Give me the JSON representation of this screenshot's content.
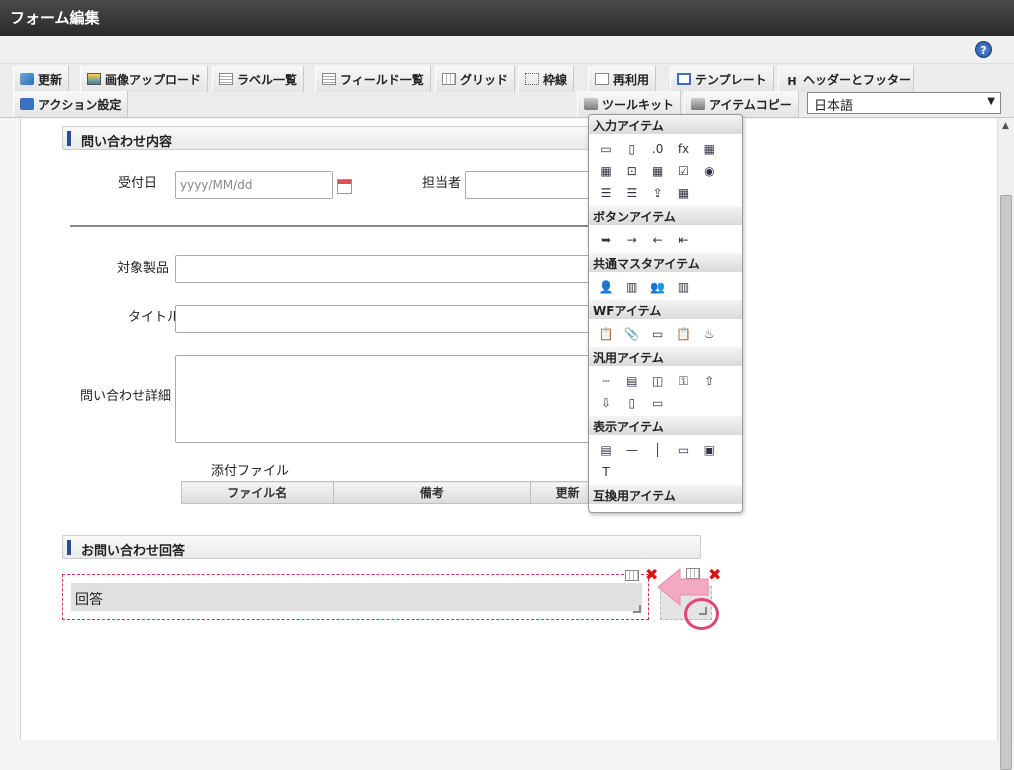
{
  "window": {
    "title": "フォーム編集",
    "help_label": "?"
  },
  "toolbar": {
    "row1": [
      {
        "label": "更新",
        "icon": "update-icon"
      },
      {
        "label": "画像アップロード",
        "icon": "image-upload-icon"
      },
      {
        "label": "ラベル一覧",
        "icon": "label-list-icon"
      },
      {
        "label": "フィールド一覧",
        "icon": "field-list-icon"
      },
      {
        "label": "グリッド",
        "icon": "grid-icon"
      },
      {
        "label": "枠線",
        "icon": "border-icon"
      },
      {
        "label": "再利用",
        "icon": "reuse-icon"
      },
      {
        "label": "テンプレート",
        "icon": "template-icon"
      },
      {
        "label": "ヘッダーとフッター",
        "icon": "header-footer-icon"
      }
    ],
    "row2": [
      {
        "label": "アクション設定",
        "icon": "action-settings-icon"
      },
      {
        "label": "ツールキット",
        "icon": "toolkit-icon"
      },
      {
        "label": "アイテムコピー",
        "icon": "item-copy-icon"
      }
    ],
    "language": {
      "selected": "日本語",
      "arrow": "▼"
    }
  },
  "form": {
    "section1": {
      "title": "問い合わせ内容"
    },
    "reception_date": {
      "label": "受付日",
      "placeholder": "yyyy/MM/dd"
    },
    "person_in_charge": {
      "label": "担当者"
    },
    "product": {
      "label": "対象製品"
    },
    "title": {
      "label": "タイトル"
    },
    "details": {
      "label": "問い合わせ詳細"
    },
    "attachments": {
      "label": "添付ファイル",
      "columns": [
        "ファイル名",
        "備考",
        "更新"
      ]
    },
    "section2": {
      "title": "お問い合わせ回答"
    },
    "answer": {
      "label": "回答"
    }
  },
  "toolkit": {
    "categories": [
      {
        "name": "入力アイテム",
        "icons": [
          "▭",
          "▯",
          ".0",
          "fx",
          "▦",
          "▦",
          "⊡",
          "▦",
          "☑",
          "◉",
          "☰",
          "☰",
          "⇪",
          "▦"
        ]
      },
      {
        "name": "ボタンアイテム",
        "icons": [
          "➥",
          "→",
          "←",
          "⇤"
        ]
      },
      {
        "name": "共通マスタアイテム",
        "icons": [
          "👤",
          "▥",
          "👥",
          "▥"
        ]
      },
      {
        "name": "WFアイテム",
        "icons": [
          "📋",
          "📎",
          "▭",
          "📋",
          "♨"
        ]
      },
      {
        "name": "汎用アイテム",
        "icons": [
          "┄",
          "▤",
          "◫",
          "⚿",
          "⇧",
          "⇩",
          "▯",
          "▭"
        ]
      },
      {
        "name": "表示アイテム",
        "icons": [
          "▤",
          "—",
          "│",
          "▭",
          "▣",
          "T"
        ]
      },
      {
        "name": "互換用アイテム",
        "icons": [
          "⊡",
          "▦",
          "☑",
          "◉",
          "☰",
          "☰"
        ]
      }
    ]
  }
}
